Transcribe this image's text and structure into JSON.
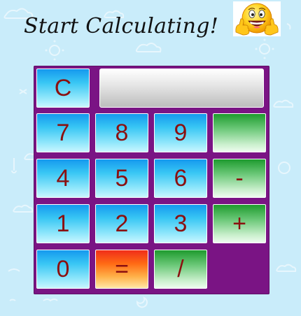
{
  "header": {
    "title": "Start Calculating!"
  },
  "emoji": {
    "icon": "thumbs-up-smiley-icon"
  },
  "calculator": {
    "display_value": "",
    "keys": {
      "clear": "C",
      "seven": "7",
      "eight": "8",
      "nine": "9",
      "blank": "",
      "four": "4",
      "five": "5",
      "six": "6",
      "minus": "-",
      "one": "1",
      "two": "2",
      "three": "3",
      "plus": "+",
      "zero": "0",
      "equals": "=",
      "divide": "/"
    },
    "colors": {
      "frame": "#7a1484",
      "key_text": "#8b1010",
      "blue_key": "#38c6f4",
      "green_key": "#6dc97a",
      "orange_key": "#ff6a14",
      "background": "#c9ecfa"
    }
  }
}
